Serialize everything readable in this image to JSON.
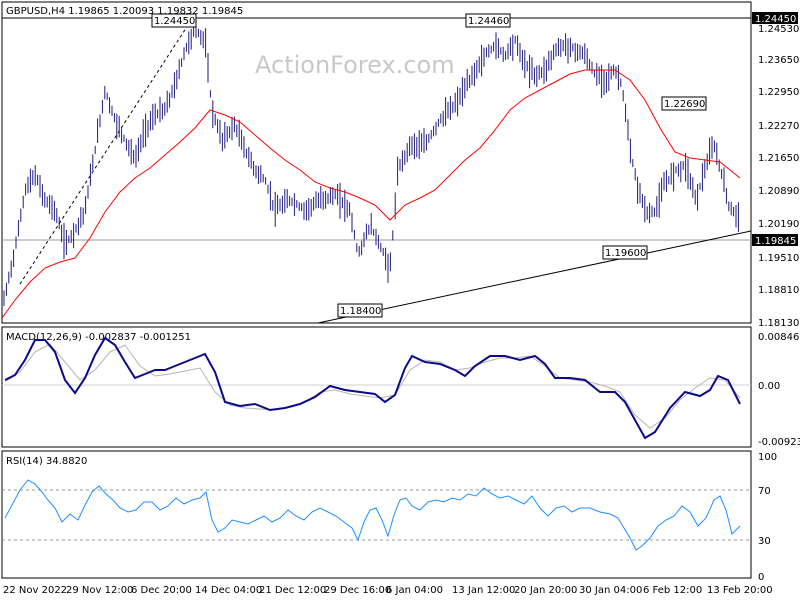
{
  "window": {
    "symbol_header": "GBPUSD,H4  1.19865 1.20093 1.19832 1.19845",
    "watermark": "ActionForex.com"
  },
  "colors": {
    "price": "#1c1c7c",
    "ma": "#ff0000",
    "macd_main": "#0a0a8a",
    "macd_signal": "#b4b4b4",
    "rsi": "#1e90ff",
    "grid": "#000000",
    "badge_bg": "#000000"
  },
  "price_panel": {
    "y_ticks": [
      "1.24530",
      "1.23650",
      "1.22950",
      "1.22270",
      "1.21650",
      "1.20890",
      "1.20190",
      "1.19510",
      "1.18810",
      "1.18130"
    ],
    "current_price": "1.19845",
    "resistance_label": "1.24450",
    "annotations": {
      "high1": "1.24450",
      "high2": "1.24460",
      "high3": "1.22690",
      "low1": "1.18400",
      "low2": "1.19600"
    }
  },
  "macd_panel": {
    "title": "MACD(12,26,9) -0.002837 -0.001251",
    "y_ticks": [
      "0.008467",
      "0.00",
      "-0.009233"
    ]
  },
  "rsi_panel": {
    "title": "RSI(14) 34.8820",
    "y_ticks": [
      "100",
      "70",
      "30",
      "0"
    ]
  },
  "time_axis": [
    "22 Nov 2022",
    "29 Nov 12:00",
    "6 Dec 20:00",
    "14 Dec 04:00",
    "21 Dec 12:00",
    "29 Dec 16:00",
    "6 Jan 04:00",
    "13 Jan 12:00",
    "20 Jan 20:00",
    "30 Jan 04:00",
    "6 Feb 12:00",
    "13 Feb 20:00"
  ],
  "chart_data": {
    "type": "line",
    "title": "GBPUSD,H4  1.19865 1.20093 1.19832 1.19845",
    "x": [
      "22 Nov 2022",
      "29 Nov 12:00",
      "6 Dec 20:00",
      "14 Dec 04:00",
      "21 Dec 12:00",
      "29 Dec 16:00",
      "6 Jan 04:00",
      "13 Jan 12:00",
      "20 Jan 20:00",
      "30 Jan 04:00",
      "6 Feb 12:00",
      "13 Feb 20:00"
    ],
    "series": [
      {
        "values": [
          1.188,
          1.212,
          1.228,
          1.244,
          1.212,
          1.198,
          1.184,
          1.236,
          1.244,
          1.236,
          1.196,
          1.198
        ]
      },
      {
        "values": [
          1.183,
          1.195,
          1.212,
          1.228,
          1.216,
          1.208,
          1.203,
          1.219,
          1.232,
          1.239,
          1.221,
          1.212
        ]
      }
    ],
    "ylim": [
      1.1813,
      1.2453
    ]
  }
}
